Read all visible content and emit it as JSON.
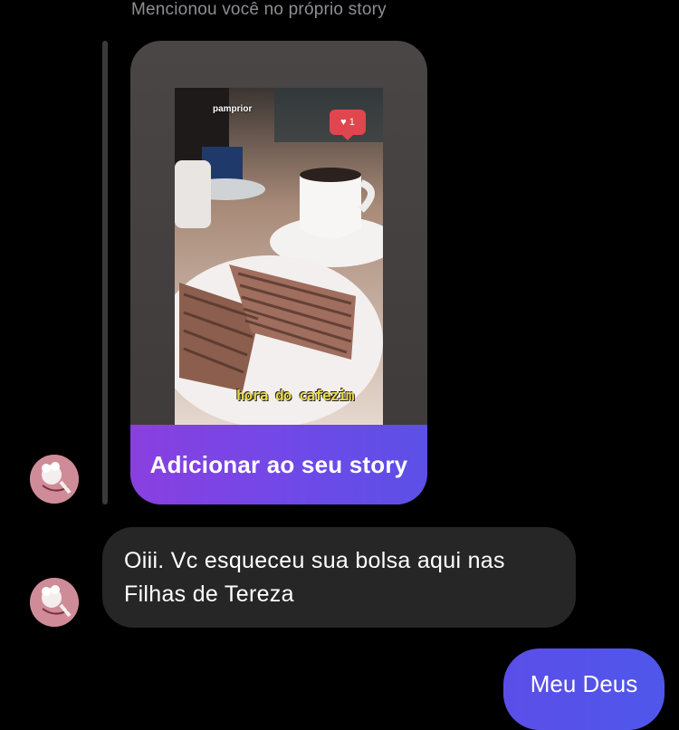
{
  "mention": {
    "note": "Mencionou você no próprio story"
  },
  "story": {
    "username": "pamprior",
    "like_count": "1",
    "caption": "hora do cafezim",
    "add_button_label": "Adicionar ao seu story"
  },
  "messages": {
    "received_text": "Oiii. Vc esqueceu sua bolsa aqui nas Filhas de Tereza",
    "sent_text": "Meu Deus"
  },
  "colors": {
    "background": "#000000",
    "received_bubble": "#262626",
    "sent_bubble": "#5b4ee8",
    "add_button": "#7a45e6",
    "avatar": "#cf8c98"
  },
  "icons": [
    "heart-icon",
    "avatar-icon"
  ]
}
